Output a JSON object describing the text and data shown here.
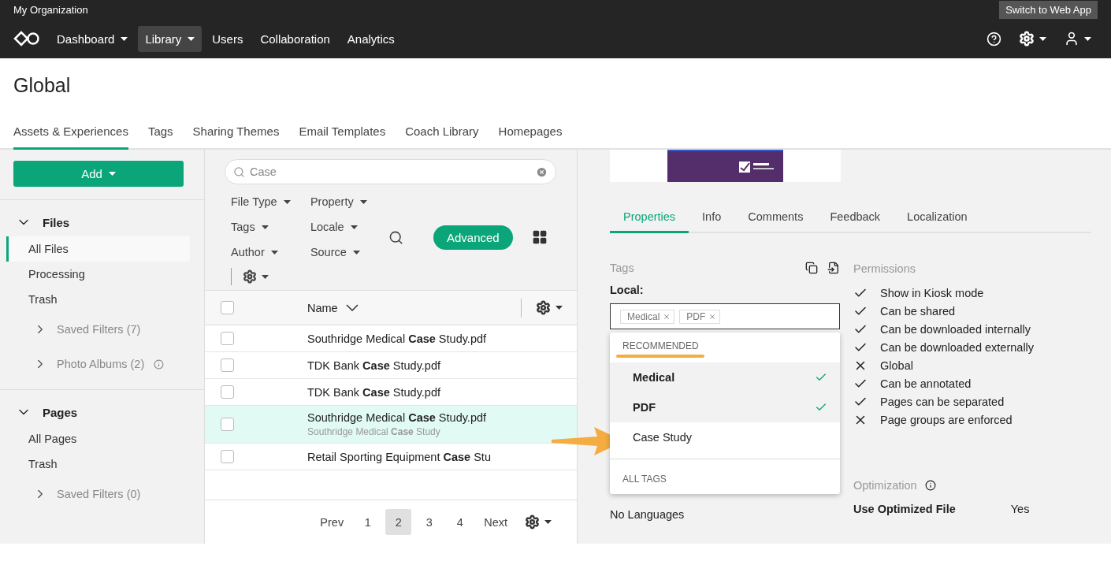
{
  "org": "My Organization",
  "switch_button": "Switch to Web App",
  "nav": [
    {
      "label": "Dashboard",
      "caret": true,
      "selected": false
    },
    {
      "label": "Library",
      "caret": true,
      "selected": true
    },
    {
      "label": "Users",
      "caret": false,
      "selected": false
    },
    {
      "label": "Collaboration",
      "caret": false,
      "selected": false
    },
    {
      "label": "Analytics",
      "caret": false,
      "selected": false
    }
  ],
  "page_title": "Global",
  "tabs": [
    {
      "label": "Assets & Experiences",
      "selected": true
    },
    {
      "label": "Tags",
      "selected": false
    },
    {
      "label": "Sharing Themes",
      "selected": false
    },
    {
      "label": "Email Templates",
      "selected": false
    },
    {
      "label": "Coach Library",
      "selected": false
    },
    {
      "label": "Homepages",
      "selected": false
    }
  ],
  "sidebar": {
    "add_button": "Add",
    "sections": [
      {
        "title": "Files",
        "expanded": true,
        "items": [
          {
            "label": "All Files",
            "selected": true
          },
          {
            "label": "Processing",
            "selected": false
          },
          {
            "label": "Trash",
            "selected": false
          }
        ],
        "groups": [
          {
            "label": "Saved Filters (7)",
            "info": false
          },
          {
            "label": "Photo Albums (2)",
            "info": true
          }
        ]
      },
      {
        "title": "Pages",
        "expanded": true,
        "items": [
          {
            "label": "All Pages",
            "selected": false
          },
          {
            "label": "Trash",
            "selected": false
          }
        ],
        "groups": [
          {
            "label": "Saved Filters (0)",
            "info": false
          }
        ]
      }
    ]
  },
  "search": {
    "value": "Case"
  },
  "filters": [
    {
      "label": "File Type"
    },
    {
      "label": "Property"
    },
    {
      "label": "Tags"
    },
    {
      "label": "Locale"
    },
    {
      "label": "Author"
    },
    {
      "label": "Source"
    }
  ],
  "advanced_button": "Advanced",
  "table": {
    "column": "Name",
    "select_all_checked": false,
    "rows": [
      {
        "name": "Southridge Medical **Case** Study.pdf",
        "selected": false
      },
      {
        "name": "TDK Bank **Case** Study.pdf",
        "selected": false
      },
      {
        "name": "TDK Bank **Case** Study.pdf",
        "selected": false
      },
      {
        "name": "Southridge Medical **Case** Study.pdf",
        "subtitle": "Southridge Medical **Case** Study",
        "selected": true
      },
      {
        "name": "Retail Sporting Equipment **Case** Stu",
        "selected": false
      }
    ]
  },
  "pagination": {
    "prev": "Prev",
    "next": "Next",
    "pages": [
      {
        "label": "1",
        "selected": false
      },
      {
        "label": "2",
        "selected": true
      },
      {
        "label": "3",
        "selected": false
      },
      {
        "label": "4",
        "selected": false
      }
    ]
  },
  "detail": {
    "tabs": [
      {
        "label": "Properties",
        "selected": true
      },
      {
        "label": "Info",
        "selected": false
      },
      {
        "label": "Comments",
        "selected": false
      },
      {
        "label": "Feedback",
        "selected": false
      },
      {
        "label": "Localization",
        "selected": false
      }
    ],
    "tags": {
      "title": "Tags",
      "local_label": "Local:",
      "chips": [
        "Medical",
        "PDF"
      ],
      "dropdown": {
        "recommended_heading": "RECOMMENDED",
        "items": [
          {
            "label": "Medical",
            "checked": true
          },
          {
            "label": "PDF",
            "checked": true
          },
          {
            "label": "Case Study",
            "checked": false
          }
        ],
        "all_heading": "ALL TAGS"
      },
      "languages": "No Languages"
    },
    "permissions": {
      "title": "Permissions",
      "items": [
        {
          "label": "Show in Kiosk mode",
          "allowed": true
        },
        {
          "label": "Can be shared",
          "allowed": true
        },
        {
          "label": "Can be downloaded internally",
          "allowed": true
        },
        {
          "label": "Can be downloaded externally",
          "allowed": true
        },
        {
          "label": "Global",
          "allowed": false
        },
        {
          "label": "Can be annotated",
          "allowed": true
        },
        {
          "label": "Pages can be separated",
          "allowed": true
        },
        {
          "label": "Page groups are enforced",
          "allowed": false
        }
      ]
    },
    "optimization": {
      "title": "Optimization",
      "rows": [
        {
          "label": "Use Optimized File",
          "value": "Yes"
        }
      ]
    }
  }
}
